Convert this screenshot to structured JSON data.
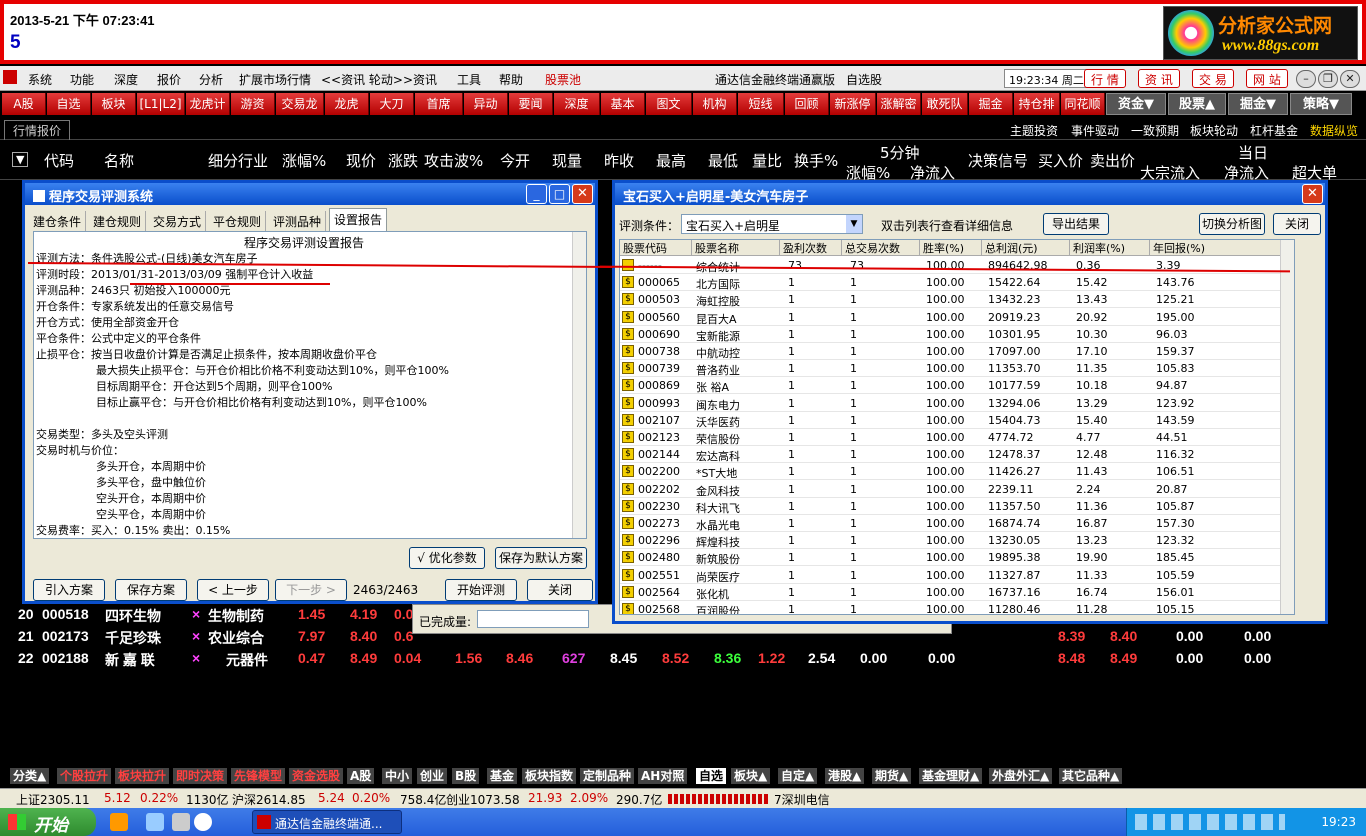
{
  "banner": {
    "datetime": "2013-5-21 下午 07:23:41",
    "number": "5",
    "logo_title": "分析家公式网",
    "logo_url": "www.88gs.com"
  },
  "menu": {
    "items": [
      "系统",
      "功能",
      "深度",
      "报价",
      "分析",
      "扩展市场行情",
      "<<资讯 轮动>>",
      "资讯",
      "工具",
      "帮助",
      "股票池"
    ],
    "app_title": "通达信金融终端通赢版",
    "section": "自选股",
    "clock": "19:23:34 周二",
    "right_buttons": [
      "行 情",
      "资 讯",
      "交 易",
      "网 站"
    ]
  },
  "toolbar": {
    "buttons": [
      "A股",
      "自选",
      "板块",
      "[L1|L2]",
      "龙虎计",
      "游资",
      "交易龙",
      "龙虎",
      "大刀",
      "首席",
      "异动",
      "要闻",
      "深度",
      "基本",
      "图文F10",
      "机构",
      "短线",
      "回顾",
      "新涨停",
      "涨解密",
      "敢死队",
      "掘金",
      "持仓排",
      "同花顺"
    ],
    "dropdowns": [
      "资金▼",
      "股票▲",
      "掘金▼",
      "策略▼"
    ]
  },
  "strip2": {
    "tab": "行情报价",
    "right_items": [
      "主题投资",
      "事件驱动",
      "一致预期",
      "板块轮动",
      "杠杆基金",
      "数据纵览"
    ]
  },
  "columns": [
    "代码",
    "名称",
    "细分行业",
    "涨幅%",
    "现价",
    "涨跌",
    "攻击波%",
    "今开",
    "现量",
    "昨收",
    "最高",
    "最低",
    "量比",
    "换手%",
    "5分钟",
    "涨幅%",
    "净流入",
    "决策信号",
    "买入价",
    "卖出价",
    "当日",
    "大宗流入",
    "净流入",
    "超大单"
  ],
  "rows": [
    {
      "no": "20",
      "code": "000518",
      "name": "四环生物",
      "mark": "×",
      "industry": "生物制药",
      "c1": "1.45",
      "c2": "4.19",
      "c3": "0.0"
    },
    {
      "no": "21",
      "code": "002173",
      "name": "千足珍珠",
      "mark": "×",
      "industry": "农业综合",
      "c1": "7.97",
      "c2": "8.40",
      "c3": "0.6",
      "r1": "8.39",
      "r2": "8.40",
      "r3": "0.00",
      "r4": "0.00"
    },
    {
      "no": "22",
      "code": "002188",
      "name": "新 嘉 联",
      "mark": "×",
      "industry": "元器件",
      "c1": "0.47",
      "c2": "8.49",
      "c3": "0.04",
      "c4": "1.56",
      "c5": "8.46",
      "c6": "627",
      "c7": "8.45",
      "c8": "8.52",
      "c9": "8.36",
      "c10": "1.22",
      "c11": "2.54",
      "c12": "0.00",
      "c13": "0.00",
      "r1": "8.48",
      "r2": "8.49",
      "r3": "0.00",
      "r4": "0.00"
    }
  ],
  "left_win": {
    "title": "程序交易评测系统",
    "tabs": [
      "建仓条件",
      "建仓规则",
      "交易方式",
      "平仓规则",
      "评测品种",
      "设置报告"
    ],
    "report_title": "程序交易评测设置报告",
    "lines": [
      "评测方法：条件选股公式-(日线)美女汽车房子",
      "评测时段：2013/01/31-2013/03/09 强制平仓计入收益",
      "评测品种：2463只 初始投入100000元",
      "开仓条件：专家系统发出的任意交易信号",
      "开仓方式：使用全部资金开仓",
      "平仓条件：公式中定义的平仓条件",
      "止损平仓：按当日收盘价计算是否满足止损条件，按本周期收盘价平仓",
      "最大损失止损平仓：与开仓价相比价格不利变动达到10%，则平仓100%",
      "目标周期平仓：开仓达到5个周期，则平仓100%",
      "目标止赢平仓：与开仓价相比价格有利变动达到10%，则平仓100%",
      "",
      "交易类型：多头及空头评测",
      "交易时机与价位：",
      "多头开仓，本周期中价",
      "多头平仓，盘中触位价",
      "空头开仓，本周期中价",
      "空头平仓，本周期中价",
      "交易费率：买入：0.15%   卖出：0.15%"
    ],
    "opt_btn": "√ 优化参数",
    "save_default": "保存为默认方案",
    "import": "引入方案",
    "save": "保存方案",
    "prev": "< 上一步",
    "next": "下一步 >",
    "count": "2463/2463",
    "start": "开始评测",
    "close": "关闭"
  },
  "right_win": {
    "title": "宝石买入+启明星-美女汽车房子",
    "cond_label": "评测条件：",
    "cond_value": "宝石买入+启明星",
    "hint": "双击列表行查看详细信息",
    "export": "导出结果",
    "switch": "切换分析图",
    "close": "关闭",
    "headers": [
      "股票代码",
      "股票名称",
      "盈利次数",
      "总交易次数",
      "胜率(%)",
      "总利润(元)",
      "利润率(%)",
      "年回报(%)"
    ],
    "rows": [
      [
        "------",
        "综合统计",
        "73",
        "73",
        "100.00",
        "894642.98",
        "0.36",
        "3.39"
      ],
      [
        "000065",
        "北方国际",
        "1",
        "1",
        "100.00",
        "15422.64",
        "15.42",
        "143.76"
      ],
      [
        "000503",
        "海虹控股",
        "1",
        "1",
        "100.00",
        "13432.23",
        "13.43",
        "125.21"
      ],
      [
        "000560",
        "昆百大A",
        "1",
        "1",
        "100.00",
        "20919.23",
        "20.92",
        "195.00"
      ],
      [
        "000690",
        "宝新能源",
        "1",
        "1",
        "100.00",
        "10301.95",
        "10.30",
        "96.03"
      ],
      [
        "000738",
        "中航动控",
        "1",
        "1",
        "100.00",
        "17097.00",
        "17.10",
        "159.37"
      ],
      [
        "000739",
        "普洛药业",
        "1",
        "1",
        "100.00",
        "11353.70",
        "11.35",
        "105.83"
      ],
      [
        "000869",
        "张 裕A",
        "1",
        "1",
        "100.00",
        "10177.59",
        "10.18",
        "94.87"
      ],
      [
        "000993",
        "闽东电力",
        "1",
        "1",
        "100.00",
        "13294.06",
        "13.29",
        "123.92"
      ],
      [
        "002107",
        "沃华医药",
        "1",
        "1",
        "100.00",
        "15404.73",
        "15.40",
        "143.59"
      ],
      [
        "002123",
        "荣信股份",
        "1",
        "1",
        "100.00",
        "4774.72",
        "4.77",
        "44.51"
      ],
      [
        "002144",
        "宏达高科",
        "1",
        "1",
        "100.00",
        "12478.37",
        "12.48",
        "116.32"
      ],
      [
        "002200",
        "*ST大地",
        "1",
        "1",
        "100.00",
        "11426.27",
        "11.43",
        "106.51"
      ],
      [
        "002202",
        "金风科技",
        "1",
        "1",
        "100.00",
        "2239.11",
        "2.24",
        "20.87"
      ],
      [
        "002230",
        "科大讯飞",
        "1",
        "1",
        "100.00",
        "11357.50",
        "11.36",
        "105.87"
      ],
      [
        "002273",
        "水晶光电",
        "1",
        "1",
        "100.00",
        "16874.74",
        "16.87",
        "157.30"
      ],
      [
        "002296",
        "辉煌科技",
        "1",
        "1",
        "100.00",
        "13230.05",
        "13.23",
        "123.32"
      ],
      [
        "002480",
        "新筑股份",
        "1",
        "1",
        "100.00",
        "19895.38",
        "19.90",
        "185.45"
      ],
      [
        "002551",
        "尚荣医疗",
        "1",
        "1",
        "100.00",
        "11327.87",
        "11.33",
        "105.59"
      ],
      [
        "002564",
        "张化机",
        "1",
        "1",
        "100.00",
        "16737.16",
        "16.74",
        "156.01"
      ],
      [
        "002568",
        "百润股份",
        "1",
        "1",
        "100.00",
        "11280.46",
        "11.28",
        "105.15"
      ]
    ]
  },
  "completed_label": "已完成量:",
  "bottom_tabs": [
    "分类▲",
    "个股拉升",
    "板块拉升",
    "即时决策",
    "先锋模型",
    "资金选股",
    "A股",
    "中小",
    "创业",
    "B股",
    "基金",
    "板块指数",
    "定制品种",
    "AH对照",
    "自选",
    "板块▲",
    "自定▲",
    "港股▲",
    "期货▲",
    "基金理财▲",
    "外盘外汇▲",
    "其它品种▲"
  ],
  "status": {
    "sh": "上证2305.11",
    "sh_chg": "5.12",
    "sh_pct": "0.22%",
    "sh_amt": "1130亿",
    "sz": "沪深2614.85",
    "sz_chg": "5.24",
    "sz_pct": "0.20%",
    "sz_amt": "758.4亿",
    "cy": "创业1073.58",
    "cy_chg": "21.93",
    "cy_pct": "2.09%",
    "cy_amt": "290.7亿",
    "broker": "7深圳电信"
  },
  "taskbar": {
    "start": "开始",
    "task": "通达信金融终端通...",
    "ime": "CH",
    "clock": "19:23"
  }
}
